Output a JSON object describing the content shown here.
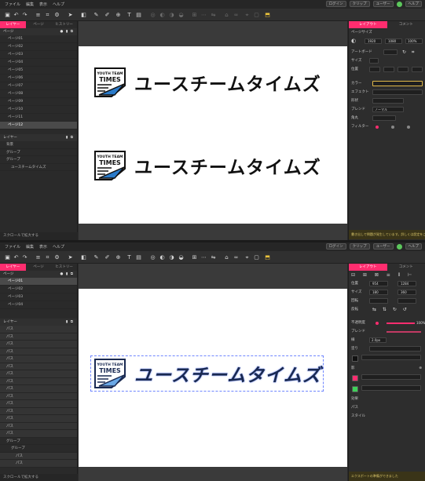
{
  "colors": {
    "accent": "#ff2d6f",
    "canvas": "#ffffff",
    "workspace": "#3a3a3a",
    "panel": "#2b2b2b",
    "warning": "#d8c56a"
  },
  "menu": {
    "items": [
      "ファイル",
      "編集",
      "表示",
      "ヘルプ"
    ],
    "pill_1": "ログイン",
    "pill_2": "クリップ",
    "avatar": "ユーザー",
    "pill_3": "ヘルプ"
  },
  "left_tabs": [
    "レイヤー",
    "ページ",
    "ヒストリー"
  ],
  "shot1": {
    "pages_header": "ページ",
    "pages": [
      "ページ01",
      "ページ02",
      "ページ03",
      "ページ04",
      "ページ05",
      "ページ06",
      "ページ07",
      "ページ08",
      "ページ09",
      "ページ10",
      "ページ11",
      "ページ12"
    ],
    "layers_header": "レイヤー",
    "layers": [
      "背景",
      "グループ",
      "グループ",
      "ユースチームタイムズ"
    ],
    "left_footer": "スクロールで拡大する",
    "logo_text": "ユースチームタイムズ",
    "badge_line1": "YOUTH TEAM",
    "badge_line2": "TIMES",
    "right_tabs": [
      "レイアウト",
      "コメント"
    ],
    "props": [
      "ページサイズ",
      "アートボード",
      "サイズ",
      "位置",
      "カラー",
      "エフェクト",
      "形状",
      "ブレンド",
      "角丸",
      "フィルター"
    ],
    "prop_values": {
      "w": "1920",
      "h": "1080",
      "zoom": "100%",
      "mode": "ノーマル"
    },
    "status": "書き出しで問題が発生しています。詳しくは設定をご確認ください。"
  },
  "shot2": {
    "pages_header": "ページ",
    "pages": [
      "ページ01",
      "ページ02",
      "ページ03",
      "ページ04"
    ],
    "layers_header": "レイヤー",
    "layers": [
      "パス",
      "パス",
      "パス",
      "パス",
      "パス",
      "パス",
      "パス",
      "パス",
      "パス",
      "パス",
      "パス",
      "パス",
      "パス",
      "パス",
      "パス",
      "グループ",
      "グループ",
      "パス",
      "パス"
    ],
    "left_footer": "スクロールで拡大する",
    "logo_text": "ユースチームタイムズ",
    "badge_line1": "YOUTH TEAM",
    "badge_line2": "TIMES",
    "right_tabs": [
      "レイアウト",
      "コメント"
    ],
    "props": [
      "位置",
      "サイズ",
      "回転",
      "反転",
      "不透明度",
      "ブレンド",
      "線",
      "塗り",
      "影",
      "効果",
      "パス",
      "スタイル"
    ],
    "prop_values": {
      "x": "954",
      "y": "1284",
      "w": "180",
      "h": "360",
      "opacity": "100%",
      "stroke": "2.0px"
    },
    "status": "エクスポートの準備ができました"
  }
}
